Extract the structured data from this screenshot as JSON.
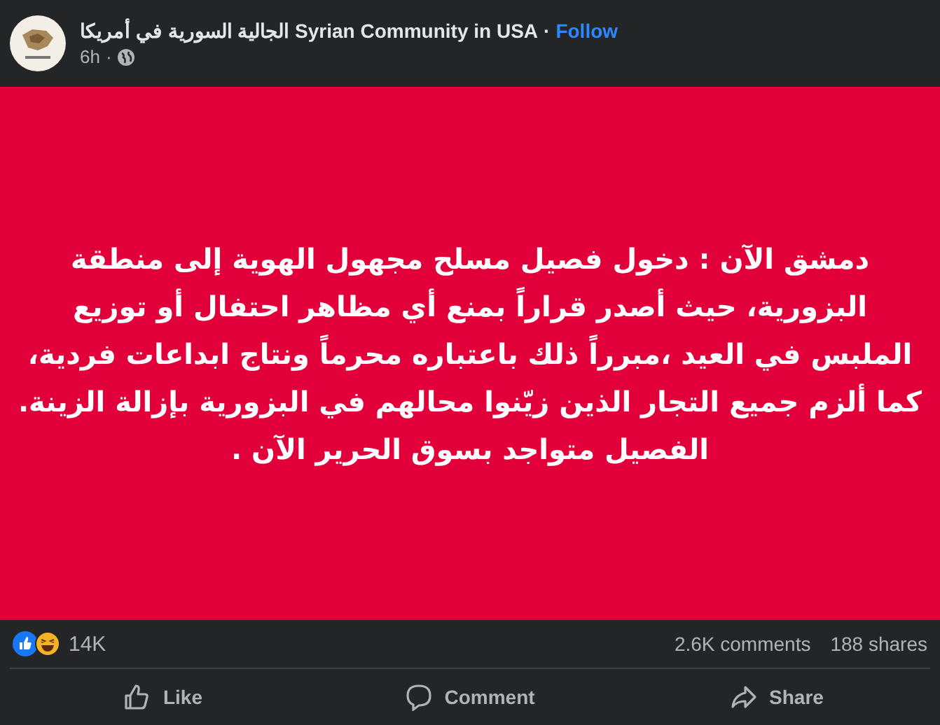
{
  "header": {
    "page_name": "الجالية السورية في أمريكا Syrian Community in USA",
    "separator": "·",
    "follow": "Follow",
    "time": "6h",
    "time_separator": "·"
  },
  "post": {
    "text": "دمشق الآن : دخول فصيل مسلح مجهول الهوية إلى منطقة\nالبزورية، حيث أصدر قراراً بمنع أي مظاهر احتفال أو توزيع\nالملبس في العيد ،مبرراً ذلك باعتباره محرماً ونتاج ابداعات فردية،\nكما ألزم جميع التجار الذين زيّنوا محالهم في البزورية بإزالة الزينة.\nالفصيل متواجد بسوق الحرير الآن ."
  },
  "stats": {
    "reactions": "14K",
    "comments": "2.6K comments",
    "shares": "188 shares"
  },
  "actions": {
    "like": "Like",
    "comment": "Comment",
    "share": "Share"
  }
}
